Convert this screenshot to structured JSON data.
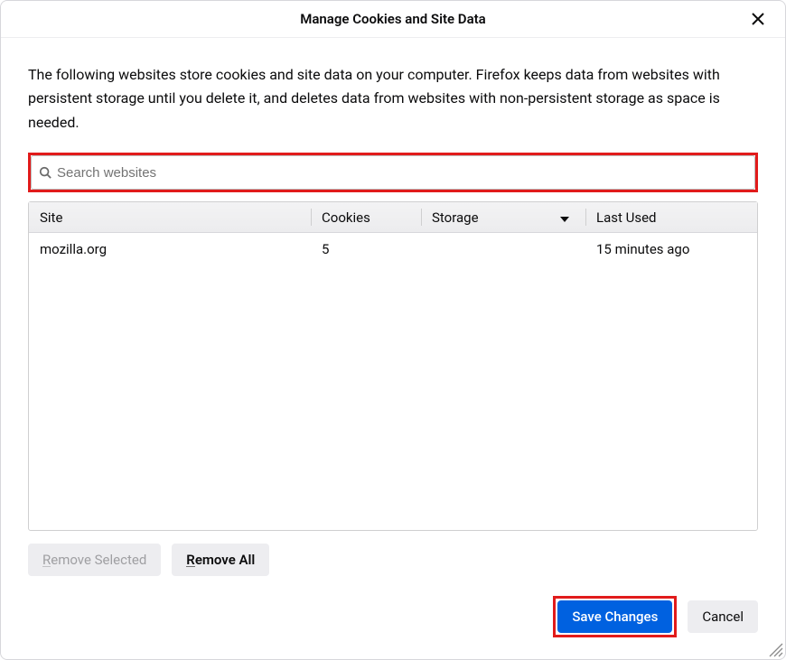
{
  "title": "Manage Cookies and Site Data",
  "intro": "The following websites store cookies and site data on your computer. Firefox keeps data from websites with persistent storage until you delete it, and deletes data from websites with non-persistent storage as space is needed.",
  "search": {
    "placeholder": "Search websites"
  },
  "columns": {
    "site": "Site",
    "cookies": "Cookies",
    "storage": "Storage",
    "last_used": "Last Used"
  },
  "rows": [
    {
      "site": "mozilla.org",
      "cookies": "5",
      "storage": "",
      "last_used": "15 minutes ago"
    }
  ],
  "buttons": {
    "remove_selected_prefix": "R",
    "remove_selected_rest": "emove Selected",
    "remove_all_prefix": "R",
    "remove_all_rest": "emove All",
    "save": "Save Changes",
    "cancel": "Cancel"
  }
}
